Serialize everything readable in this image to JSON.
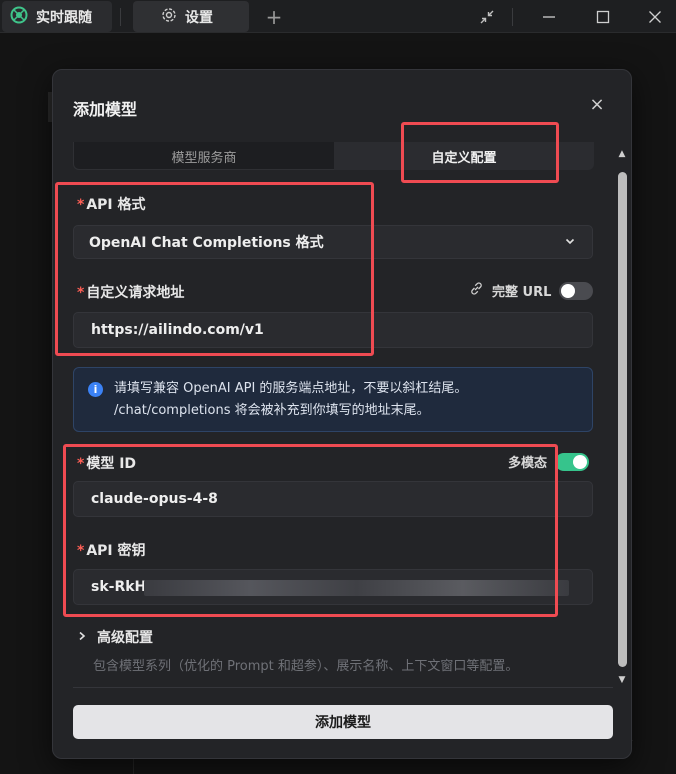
{
  "titlebar": {
    "tabs": [
      {
        "label": "实时跟随"
      },
      {
        "label": "设置"
      }
    ],
    "add_tab": "+"
  },
  "modal": {
    "title": "添加模型",
    "close": "×",
    "segment": {
      "left_label": "模型服务商",
      "right_label": "自定义配置",
      "selected": "自定义配置"
    },
    "api_format": {
      "label": "API 格式",
      "value": "OpenAI Chat Completions 格式"
    },
    "request_url": {
      "label": "自定义请求地址",
      "full_url_label": "完整 URL",
      "full_url_on": false,
      "value": "https://ailindo.com/v1"
    },
    "info": {
      "line1": "请填写兼容 OpenAI API 的服务端点地址，不要以斜杠结尾。",
      "line2": "/chat/completions 将会被补充到你填写的地址末尾。"
    },
    "model_id": {
      "label": "模型 ID",
      "multimodal_label": "多模态",
      "multimodal_on": true,
      "value": "claude-opus-4-8"
    },
    "api_key": {
      "label": "API 密钥",
      "value_prefix": "sk-RkH"
    },
    "advanced": {
      "label": "高级配置",
      "description": "包含模型系列（优化的 Prompt 和超参）、展示名称、上下文窗口等配置。"
    },
    "submit_label": "添加模型"
  },
  "colors": {
    "accent_green": "#36c48c",
    "annotation_red": "#ef4b52",
    "info_blue": "#3b82f6"
  }
}
